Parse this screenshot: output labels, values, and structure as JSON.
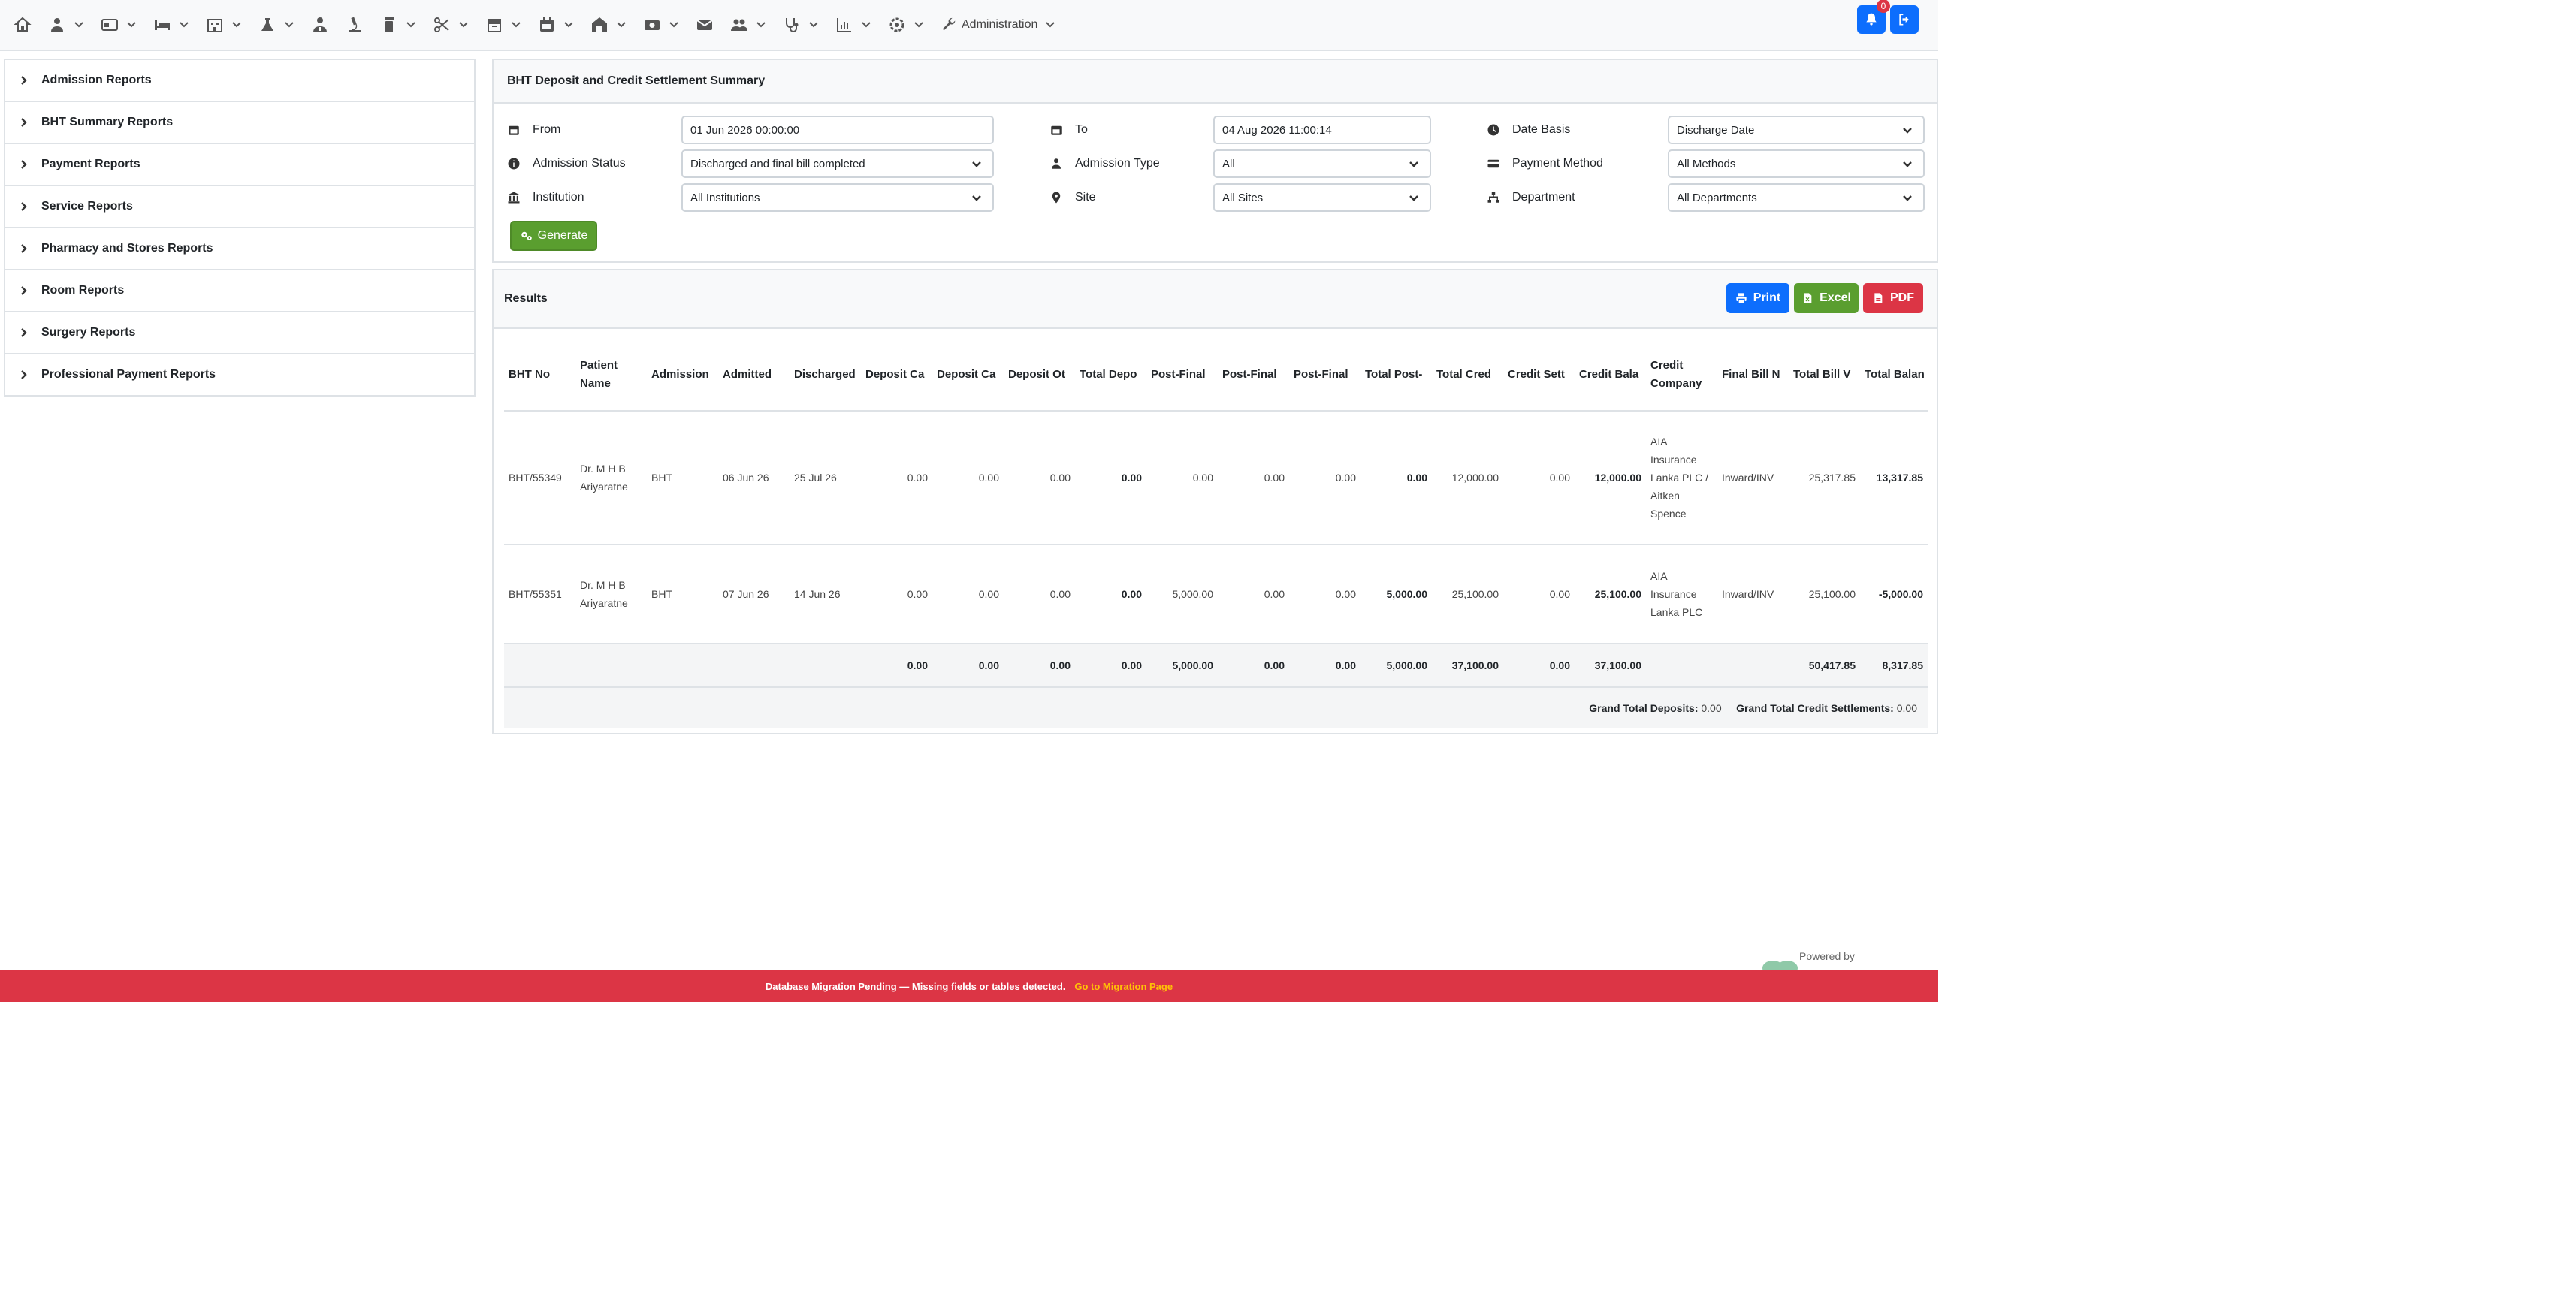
{
  "nav": {
    "icons": [
      "home-icon",
      "patient-icon",
      "billing-icon",
      "bed-icon",
      "hospital-icon",
      "lab-flask-icon",
      "doctor-icon",
      "microscope-icon",
      "pharmacy-icon",
      "surgery-scissors-icon",
      "store-icon",
      "calendar-icon",
      "inventory-icon",
      "cash-icon",
      "mail-icon",
      "staff-icon",
      "stethoscope-icon",
      "chart-icon",
      "settings-icon"
    ],
    "admin_label": "Administration",
    "notification_count": "0"
  },
  "sidebar": {
    "items": [
      {
        "label": "Admission Reports"
      },
      {
        "label": "BHT Summary Reports"
      },
      {
        "label": "Payment Reports"
      },
      {
        "label": "Service Reports"
      },
      {
        "label": "Pharmacy and Stores Reports"
      },
      {
        "label": "Room Reports"
      },
      {
        "label": "Surgery Reports"
      },
      {
        "label": "Professional Payment Reports"
      }
    ]
  },
  "filters": {
    "title": "BHT Deposit and Credit Settlement Summary",
    "from_label": "From",
    "from_value": "01 Jun 2026 00:00:00",
    "to_label": "To",
    "to_value": "04 Aug 2026 11:00:14",
    "date_basis_label": "Date Basis",
    "date_basis_value": "Discharge Date",
    "admission_status_label": "Admission Status",
    "admission_status_value": "Discharged and final bill completed",
    "admission_type_label": "Admission Type",
    "admission_type_value": "All",
    "payment_method_label": "Payment Method",
    "payment_method_value": "All Methods",
    "institution_label": "Institution",
    "institution_value": "All Institutions",
    "site_label": "Site",
    "site_value": "All Sites",
    "department_label": "Department",
    "department_value": "All Departments",
    "generate_label": "Generate"
  },
  "results": {
    "title": "Results",
    "print_label": "Print",
    "excel_label": "Excel",
    "pdf_label": "PDF",
    "columns": [
      "BHT No",
      "Patient Name",
      "Admission",
      "Admitted",
      "Discharged",
      "Deposit Ca",
      "Deposit Ca",
      "Deposit Ot",
      "Total Depo",
      "Post-Final",
      "Post-Final",
      "Post-Final",
      "Total Post-",
      "Total Cred",
      "Credit Sett",
      "Credit Bala",
      "Credit Company",
      "Final Bill N",
      "Total Bill V",
      "Total Balan"
    ],
    "rows": [
      {
        "bht": "BHT/55349",
        "patient": "Dr. M H B Ariyaratne",
        "admission": "BHT",
        "admitted": "06 Jun 26",
        "discharged": "25 Jul 26",
        "c1": "0.00",
        "c2": "0.00",
        "c3": "0.00",
        "c4": "0.00",
        "c5": "0.00",
        "c6": "0.00",
        "c7": "0.00",
        "c8": "0.00",
        "c9": "12,000.00",
        "c10": "0.00",
        "c11": "12,000.00",
        "company": "AIA Insurance Lanka PLC / Aitken Spence",
        "finalbill": "Inward/INV",
        "totalbill": "25,317.85",
        "balance": "13,317.85"
      },
      {
        "bht": "BHT/55351",
        "patient": "Dr. M H B Ariyaratne",
        "admission": "BHT",
        "admitted": "07 Jun 26",
        "discharged": "14 Jun 26",
        "c1": "0.00",
        "c2": "0.00",
        "c3": "0.00",
        "c4": "0.00",
        "c5": "5,000.00",
        "c6": "0.00",
        "c7": "0.00",
        "c8": "5,000.00",
        "c9": "25,100.00",
        "c10": "0.00",
        "c11": "25,100.00",
        "company": "AIA Insurance Lanka PLC",
        "finalbill": "Inward/INV",
        "totalbill": "25,100.00",
        "balance": "-5,000.00"
      }
    ],
    "totals": {
      "c1": "0.00",
      "c2": "0.00",
      "c3": "0.00",
      "c4": "0.00",
      "c5": "5,000.00",
      "c6": "0.00",
      "c7": "0.00",
      "c8": "5,000.00",
      "c9": "37,100.00",
      "c10": "0.00",
      "c11": "37,100.00",
      "totalbill": "50,417.85",
      "balance": "8,317.85"
    },
    "grand_deposits_label": "Grand Total Deposits:",
    "grand_deposits_value": "0.00",
    "grand_credit_label": "Grand Total Credit Settlements:",
    "grand_credit_value": "0.00"
  },
  "footer": {
    "powered_by": "Powered by",
    "banner_text": "Database Migration Pending — Missing fields or tables detected.",
    "banner_link": "Go to Migration Page"
  }
}
